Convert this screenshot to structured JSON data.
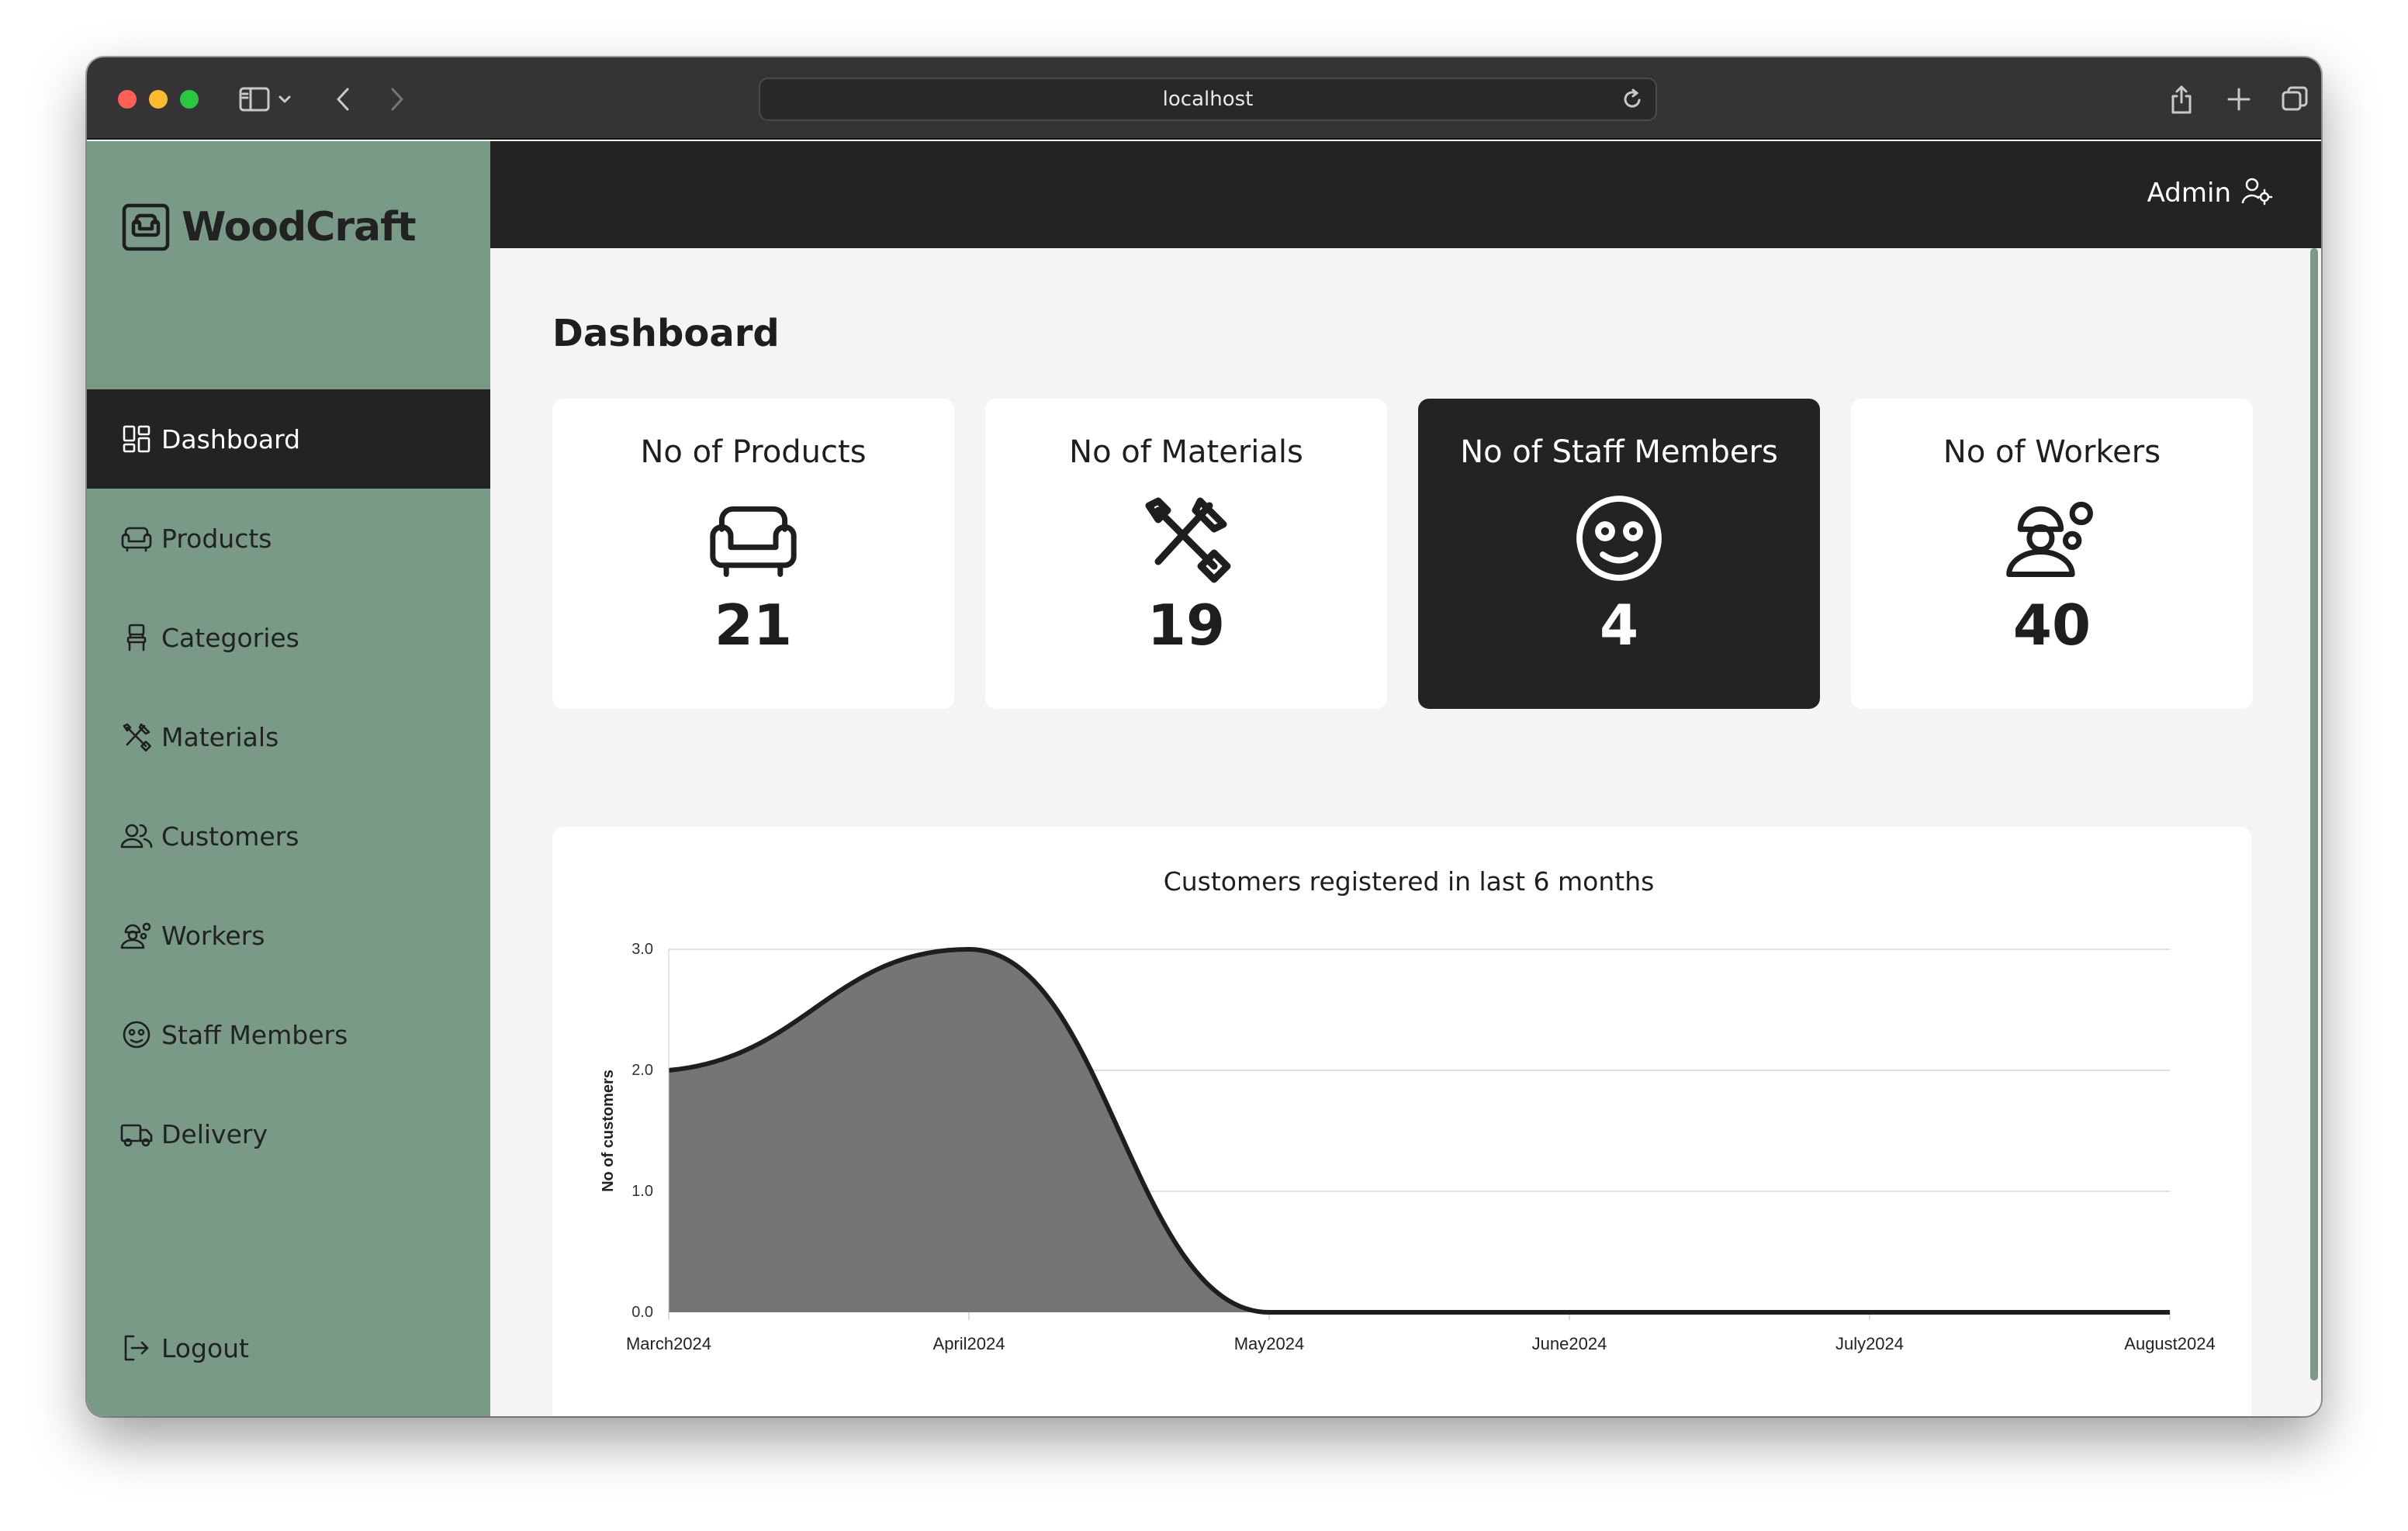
{
  "browser": {
    "url": "localhost"
  },
  "sidebar": {
    "brand": "WoodCraft",
    "items": [
      {
        "label": "Dashboard",
        "icon": "dashboard-icon",
        "active": true
      },
      {
        "label": "Products",
        "icon": "sofa-icon",
        "active": false
      },
      {
        "label": "Categories",
        "icon": "chair-icon",
        "active": false
      },
      {
        "label": "Materials",
        "icon": "tools-icon",
        "active": false
      },
      {
        "label": "Customers",
        "icon": "people-icon",
        "active": false
      },
      {
        "label": "Workers",
        "icon": "worker-gear-icon",
        "active": false
      },
      {
        "label": "Staff Members",
        "icon": "staff-face-icon",
        "active": false
      },
      {
        "label": "Delivery",
        "icon": "truck-icon",
        "active": false
      }
    ],
    "logout": "Logout"
  },
  "header": {
    "user": "Admin"
  },
  "main": {
    "title": "Dashboard",
    "cards": [
      {
        "title": "No of Products",
        "value": "21",
        "icon": "sofa-icon"
      },
      {
        "title": "No of Materials",
        "value": "19",
        "icon": "tools-icon"
      },
      {
        "title": "No of Staff Members",
        "value": "4",
        "icon": "staff-face-icon",
        "highlighted": true
      },
      {
        "title": "No of Workers",
        "value": "40",
        "icon": "worker-gear-icon"
      }
    ]
  },
  "colors": {
    "sidebar": "#789a87",
    "dark": "#232323",
    "content_bg": "#f4f4f4",
    "area_fill": "#757575"
  },
  "chart_data": {
    "type": "area",
    "title": "Customers registered in last 6 months",
    "ylabel": "No of customers",
    "xlabel": "",
    "categories": [
      "March2024",
      "April2024",
      "May2024",
      "June2024",
      "July2024",
      "August2024"
    ],
    "values": [
      2,
      3,
      0,
      0,
      0,
      0
    ],
    "ylim": [
      0,
      3
    ],
    "yticks": [
      "0.0",
      "1.0",
      "2.0",
      "3.0"
    ],
    "grid": true,
    "smooth": true
  }
}
